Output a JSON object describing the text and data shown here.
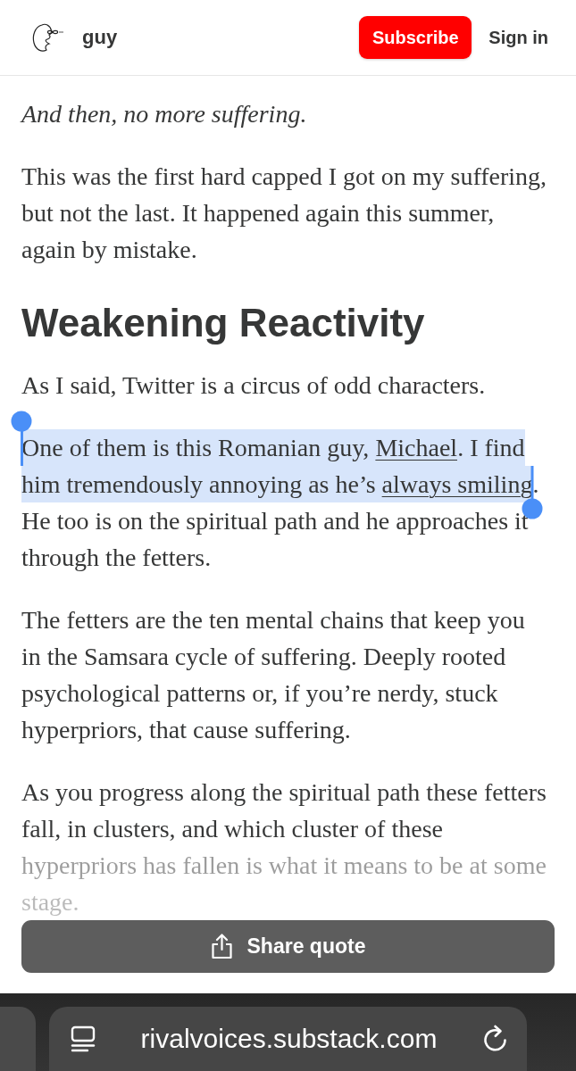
{
  "header": {
    "site_name": "guy",
    "subscribe": "Subscribe",
    "sign_in": "Sign in"
  },
  "article": {
    "blocks": [
      {
        "kind": "paragraph",
        "italic": true,
        "faded": false,
        "text": "And then, no more suffering."
      },
      {
        "kind": "paragraph",
        "italic": false,
        "faded": false,
        "text": "This was the first hard capped I got on my suffering, but not the last. It happened again this summer, again by mistake."
      },
      {
        "kind": "heading",
        "text": "Weakening Reactivity"
      },
      {
        "kind": "paragraph",
        "italic": false,
        "faded": false,
        "text": "As I said, Twitter is a circus of odd characters."
      },
      {
        "kind": "paragraph",
        "italic": false,
        "faded": false,
        "segments": [
          {
            "kind": "text",
            "text": "One of them is this Romanian guy, ",
            "selected": true
          },
          {
            "kind": "link",
            "text": "Michael",
            "selected": true
          },
          {
            "kind": "text",
            "text": ". I find him tremendously annoying as he’s ",
            "selected": true
          },
          {
            "kind": "link",
            "text": "always smiling",
            "selected": true
          },
          {
            "kind": "text",
            "text": ". He too is on the spiritual path and he approaches it through the fetters.",
            "selected": false
          }
        ]
      },
      {
        "kind": "paragraph",
        "italic": false,
        "faded": false,
        "text": "The fetters are the ten mental chains that keep you in the Samsara cycle of suffering. Deeply rooted psychological patterns or, if you’re nerdy, stuck hyperpriors, that cause suffering."
      },
      {
        "kind": "paragraph",
        "italic": false,
        "faded": true,
        "text": "As you progress along the spiritual path these fetters fall, in clusters, and which cluster of these hyperpriors has fallen is what it means to be at some stage."
      }
    ]
  },
  "share_button": {
    "label": "Share quote"
  },
  "browser": {
    "url": "rivalvoices.substack.com"
  }
}
